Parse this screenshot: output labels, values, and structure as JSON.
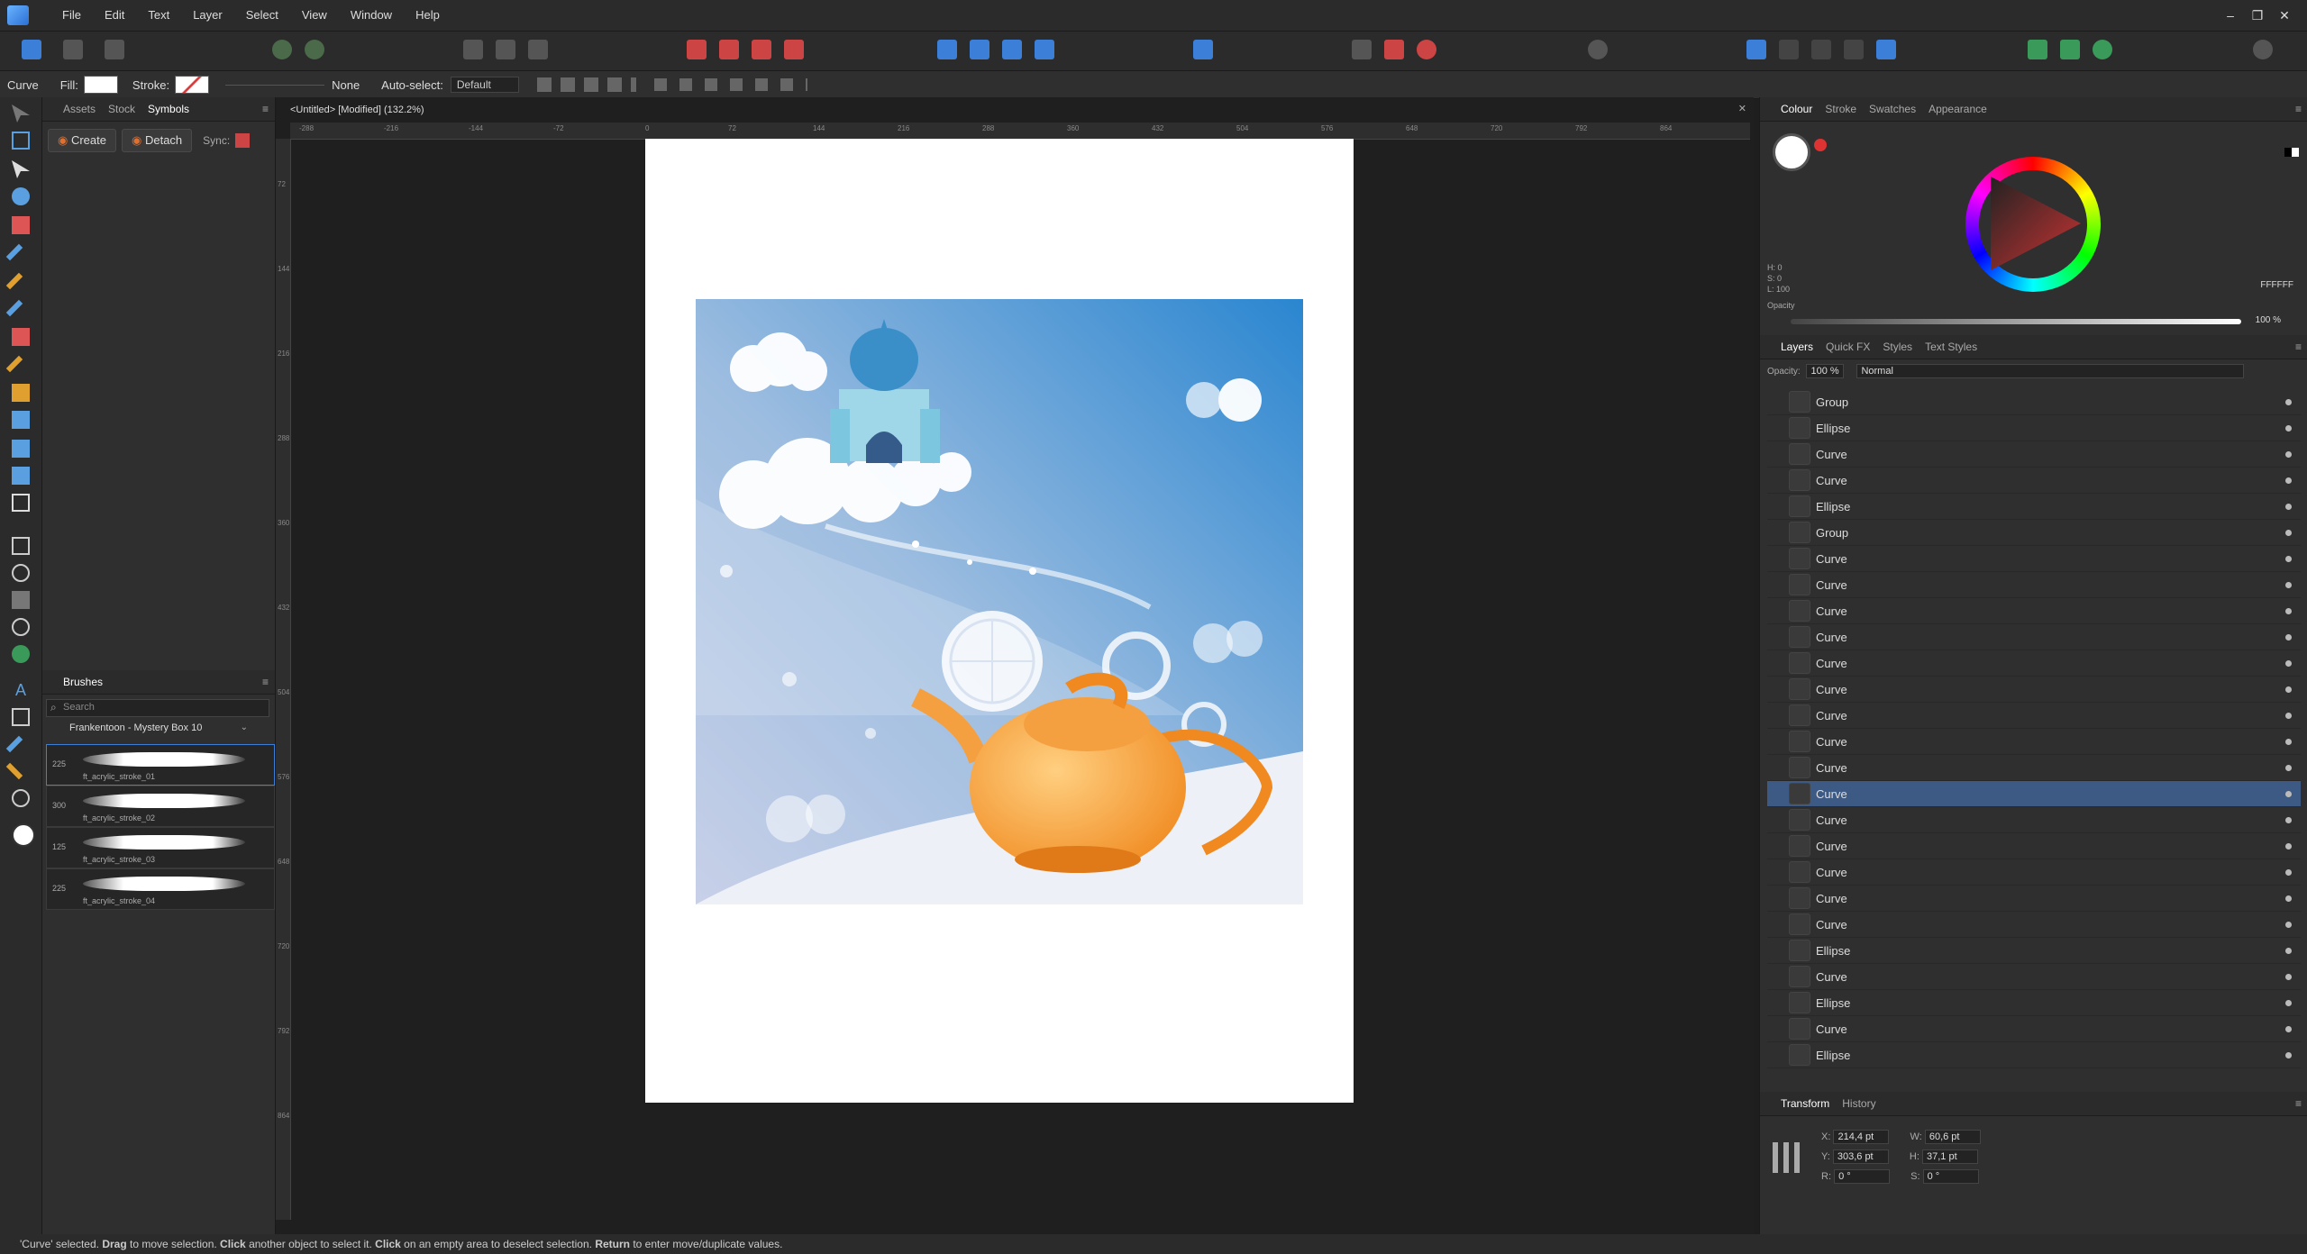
{
  "menu": [
    "File",
    "Edit",
    "Text",
    "Layer",
    "Select",
    "View",
    "Window",
    "Help"
  ],
  "context": {
    "tool_name": "Curve",
    "fill_label": "Fill:",
    "stroke_label": "Stroke:",
    "stroke_value": "None",
    "autoselect_label": "Auto-select:",
    "autoselect_value": "Default"
  },
  "left_panel": {
    "tabs": [
      "Assets",
      "Stock",
      "Symbols"
    ],
    "create_label": "Create",
    "detach_label": "Detach",
    "sync_label": "Sync:",
    "brushes_title": "Brushes",
    "search_placeholder": "Search",
    "category": "Frankentoon - Mystery Box 10",
    "brushes": [
      {
        "size": "225",
        "name": "ft_acrylic_stroke_01"
      },
      {
        "size": "300",
        "name": "ft_acrylic_stroke_02"
      },
      {
        "size": "125",
        "name": "ft_acrylic_stroke_03"
      },
      {
        "size": "225",
        "name": "ft_acrylic_stroke_04"
      }
    ]
  },
  "document": {
    "tab_title": "<Untitled> [Modified] (132.2%)",
    "ruler_h": [
      "-288",
      "-216",
      "-144",
      "-72",
      "0",
      "72",
      "144",
      "216",
      "288",
      "360",
      "432",
      "504",
      "576",
      "648",
      "720",
      "792",
      "864"
    ],
    "ruler_v": [
      "72",
      "144",
      "216",
      "288",
      "360",
      "432",
      "504",
      "576",
      "648",
      "720",
      "792",
      "864"
    ]
  },
  "colour_panel": {
    "tabs": [
      "Colour",
      "Stroke",
      "Swatches",
      "Appearance"
    ],
    "h": "H: 0",
    "s": "S: 0",
    "l": "L: 100",
    "hex": "FFFFFF",
    "opacity_label": "Opacity",
    "opacity_value": "100 %"
  },
  "layers_panel": {
    "tabs": [
      "Layers",
      "Quick FX",
      "Styles",
      "Text Styles"
    ],
    "opacity_label": "Opacity:",
    "opacity_value": "100 %",
    "blend_mode": "Normal",
    "items": [
      "Group",
      "Ellipse",
      "Curve",
      "Curve",
      "Ellipse",
      "Group",
      "Curve",
      "Curve",
      "Curve",
      "Curve",
      "Curve",
      "Curve",
      "Curve",
      "Curve",
      "Curve",
      "Curve",
      "Curve",
      "Curve",
      "Curve",
      "Curve",
      "Curve",
      "Ellipse",
      "Curve",
      "Ellipse",
      "Curve",
      "Ellipse"
    ],
    "selected_index": 15
  },
  "transform_panel": {
    "tabs": [
      "Transform",
      "History"
    ],
    "x": "214,4 pt",
    "y": "303,6 pt",
    "w": "60,6 pt",
    "h": "37,1 pt",
    "r": "0 °",
    "s": "0 °",
    "x_label": "X:",
    "y_label": "Y:",
    "w_label": "W:",
    "h_label": "H:",
    "r_label": "R:",
    "s_label": "S:"
  },
  "status": {
    "prefix": "'Curve' selected.",
    "drag": "Drag",
    "t1": " to move selection. ",
    "click1": "Click",
    "t2": " another object to select it. ",
    "click2": "Click",
    "t3": " on an empty area to deselect selection. ",
    "ret": "Return",
    "t4": " to enter move/duplicate values."
  }
}
